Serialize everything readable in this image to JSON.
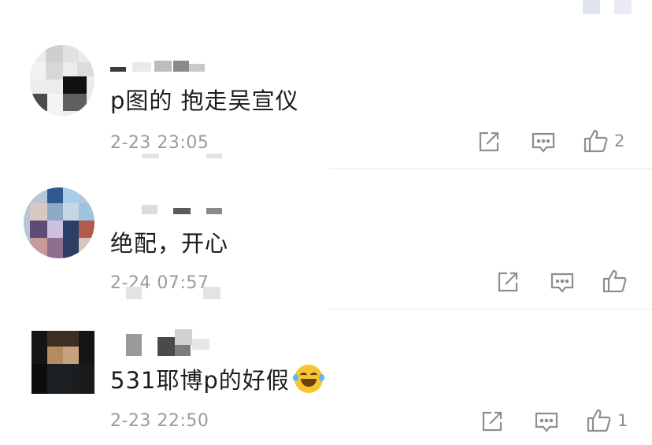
{
  "comments": [
    {
      "text": "p图的 抱走吴宣仪",
      "time": "2-23 23:05",
      "likes": "2",
      "avatar_icon": "pixelated-avatar-icon"
    },
    {
      "text": "绝配，开心",
      "time": "2-24 07:57",
      "likes": "",
      "avatar_icon": "pixelated-avatar-icon"
    },
    {
      "text": "531耶博p的好假",
      "emoji": "laughing-tears-emoji-icon",
      "time": "2-23 22:50",
      "likes": "1",
      "avatar_icon": "pixelated-avatar-icon"
    }
  ],
  "actions": {
    "share_icon": "share-icon",
    "reply_icon": "comment-icon",
    "like_icon": "thumbs-up-icon"
  },
  "colors": {
    "text": "#1b1b1b",
    "meta": "#9b9b9b",
    "icon": "#8e8e8e",
    "divider": "#e6e6e6"
  }
}
